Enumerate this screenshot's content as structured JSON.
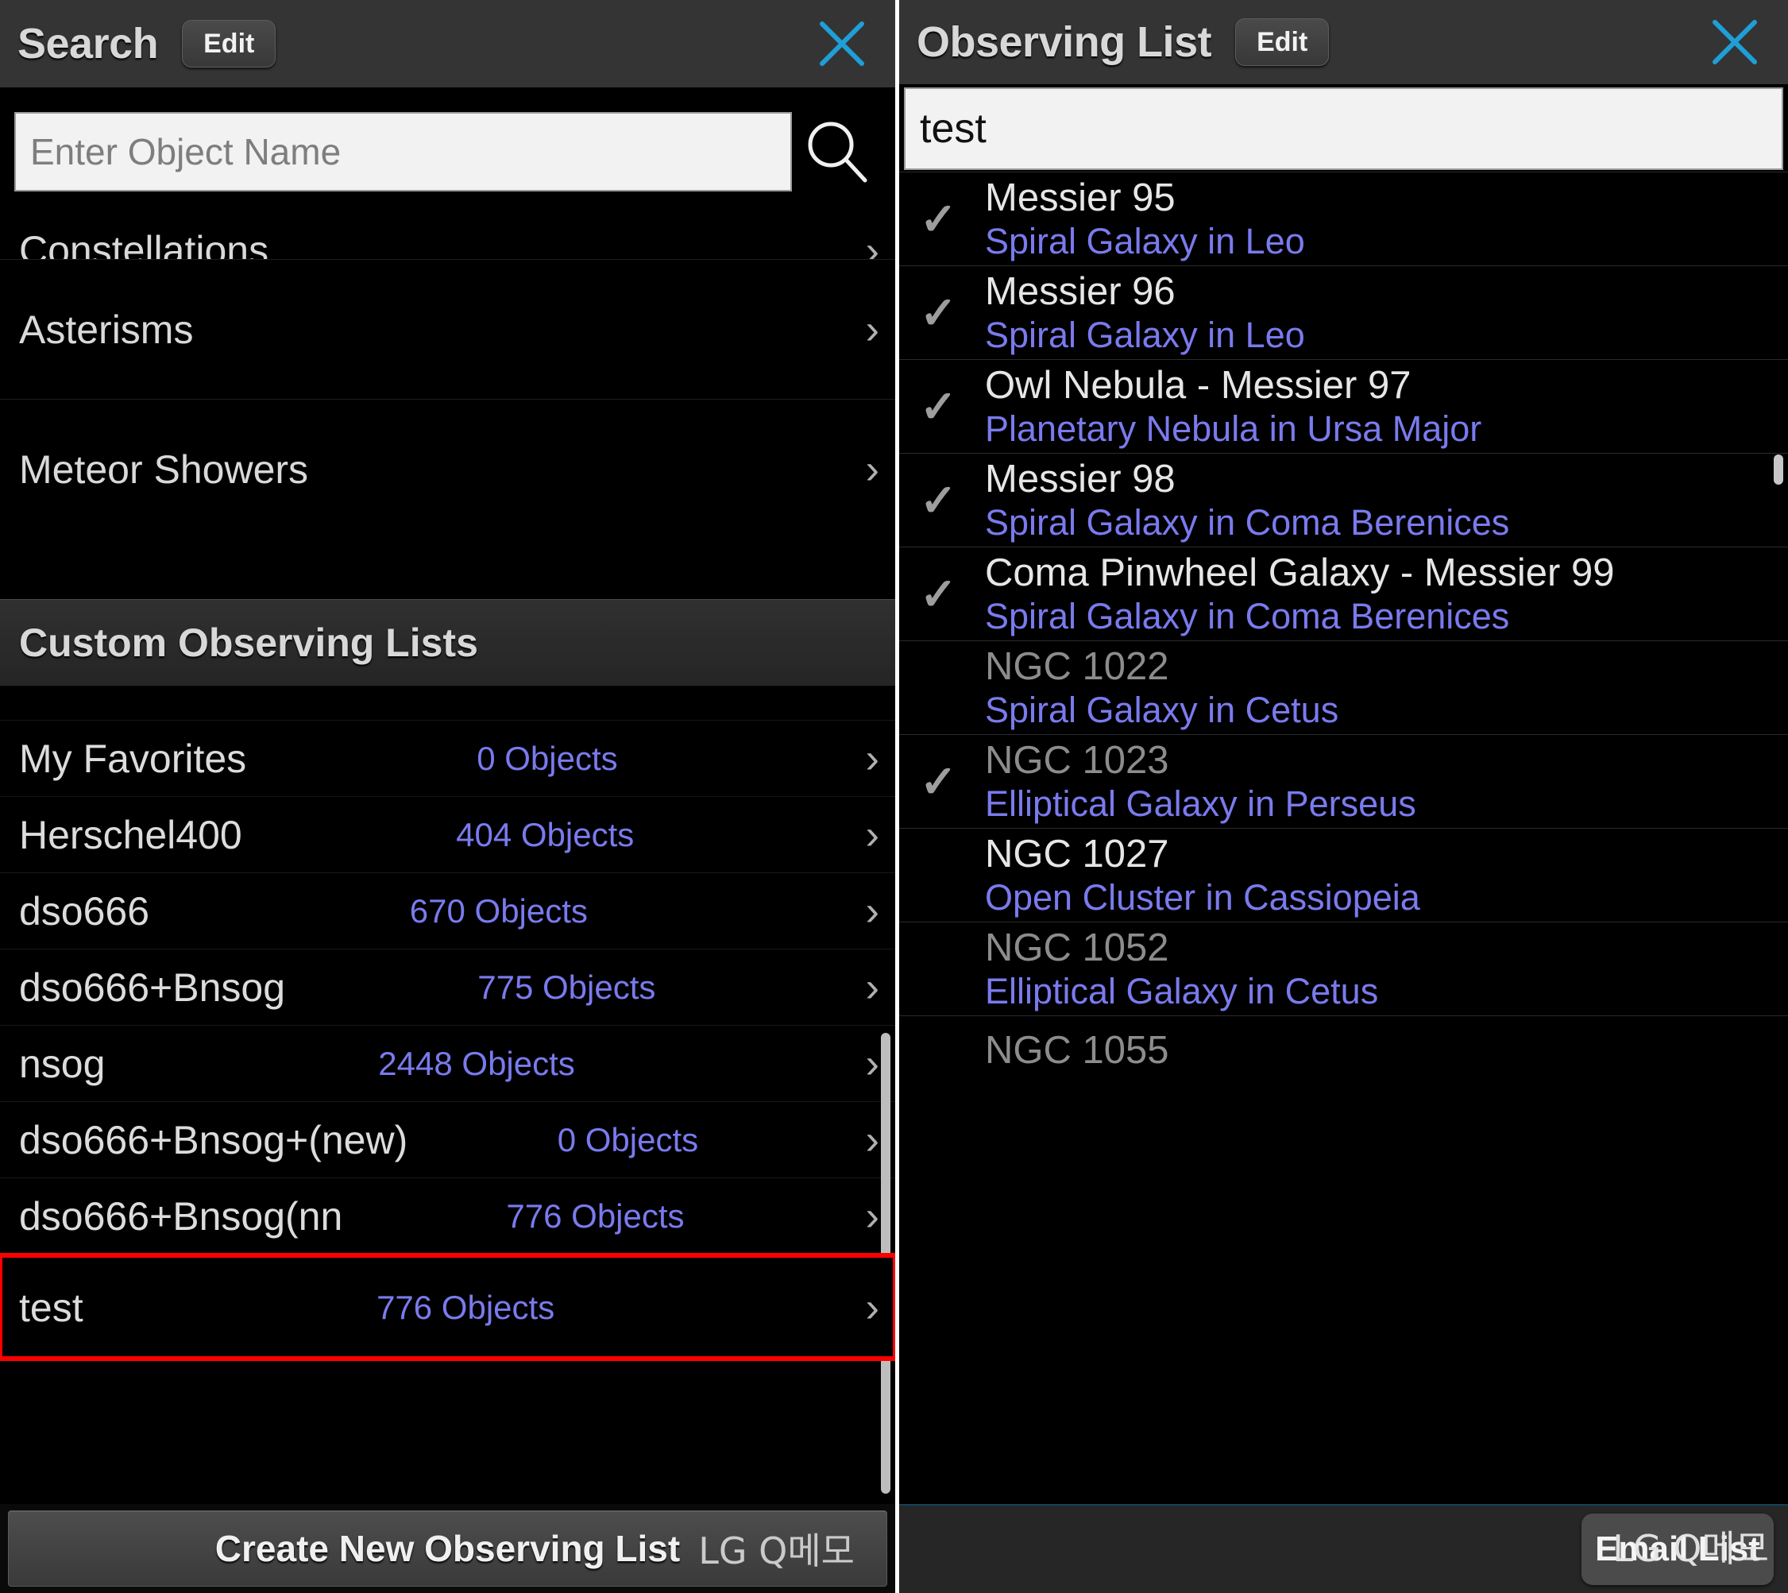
{
  "colors": {
    "accent_blue": "#7a7aee",
    "close_icon_blue": "#1f9fd8",
    "highlight_red": "#ff0000",
    "panel_bg": "#000000",
    "titlebar_bg": "#343434"
  },
  "left_panel": {
    "title": "Search",
    "edit_label": "Edit",
    "close_icon": "close-icon",
    "search": {
      "placeholder": "Enter Object Name",
      "value": "",
      "icon": "search-icon"
    },
    "nav_items": [
      {
        "label": "Constellations",
        "chevron": "›",
        "clipped": true
      },
      {
        "label": "Asterisms",
        "chevron": "›",
        "clipped": false
      },
      {
        "label": "Meteor Showers",
        "chevron": "›",
        "clipped": false
      }
    ],
    "section_header": "Custom Observing Lists",
    "lists": [
      {
        "name": "My Favorites",
        "count": "0 Objects",
        "chevron": "›",
        "highlighted": false
      },
      {
        "name": "Herschel400",
        "count": "404 Objects",
        "chevron": "›",
        "highlighted": false
      },
      {
        "name": "dso666",
        "count": "670 Objects",
        "chevron": "›",
        "highlighted": false
      },
      {
        "name": "dso666+Bnsog",
        "count": "775 Objects",
        "chevron": "›",
        "highlighted": false
      },
      {
        "name": "nsog",
        "count": "2448 Objects",
        "chevron": "›",
        "highlighted": false
      },
      {
        "name": "dso666+Bnsog+(new)",
        "count": "0 Objects",
        "chevron": "›",
        "highlighted": false
      },
      {
        "name": "dso666+Bnsog(nn",
        "count": "776 Objects",
        "chevron": "›",
        "highlighted": false
      },
      {
        "name": "test",
        "count": "776 Objects",
        "chevron": "›",
        "highlighted": true
      }
    ],
    "create_button": "Create New Observing List",
    "watermark": "LG Q메모"
  },
  "right_panel": {
    "title": "Observing List",
    "edit_label": "Edit",
    "close_icon": "close-icon",
    "search": {
      "value": "test",
      "placeholder": ""
    },
    "objects": [
      {
        "name": "Messier 95",
        "type": "Spiral Galaxy in Leo",
        "checked": true,
        "dim": false,
        "partial": false
      },
      {
        "name": "Messier 96",
        "type": "Spiral Galaxy in Leo",
        "checked": true,
        "dim": false,
        "partial": false
      },
      {
        "name": "Owl Nebula - Messier 97",
        "type": "Planetary Nebula in Ursa Major",
        "checked": true,
        "dim": false,
        "partial": false
      },
      {
        "name": "Messier 98",
        "type": "Spiral Galaxy in Coma Berenices",
        "checked": true,
        "dim": false,
        "partial": false
      },
      {
        "name": "Coma Pinwheel Galaxy - Messier 99",
        "type": "Spiral Galaxy in Coma Berenices",
        "checked": true,
        "dim": false,
        "partial": false
      },
      {
        "name": "NGC 1022",
        "type": "Spiral Galaxy in Cetus",
        "checked": false,
        "dim": true,
        "partial": false
      },
      {
        "name": "NGC 1023",
        "type": "Elliptical Galaxy in Perseus",
        "checked": true,
        "dim": true,
        "partial": false
      },
      {
        "name": "NGC 1027",
        "type": "Open Cluster in Cassiopeia",
        "checked": false,
        "dim": false,
        "partial": false
      },
      {
        "name": "NGC 1052",
        "type": "Elliptical Galaxy in Cetus",
        "checked": false,
        "dim": true,
        "partial": false
      },
      {
        "name": "NGC 1055",
        "type": "",
        "checked": false,
        "dim": true,
        "partial": true
      }
    ],
    "email_button": "Email List",
    "watermark": "LG Q메모"
  }
}
